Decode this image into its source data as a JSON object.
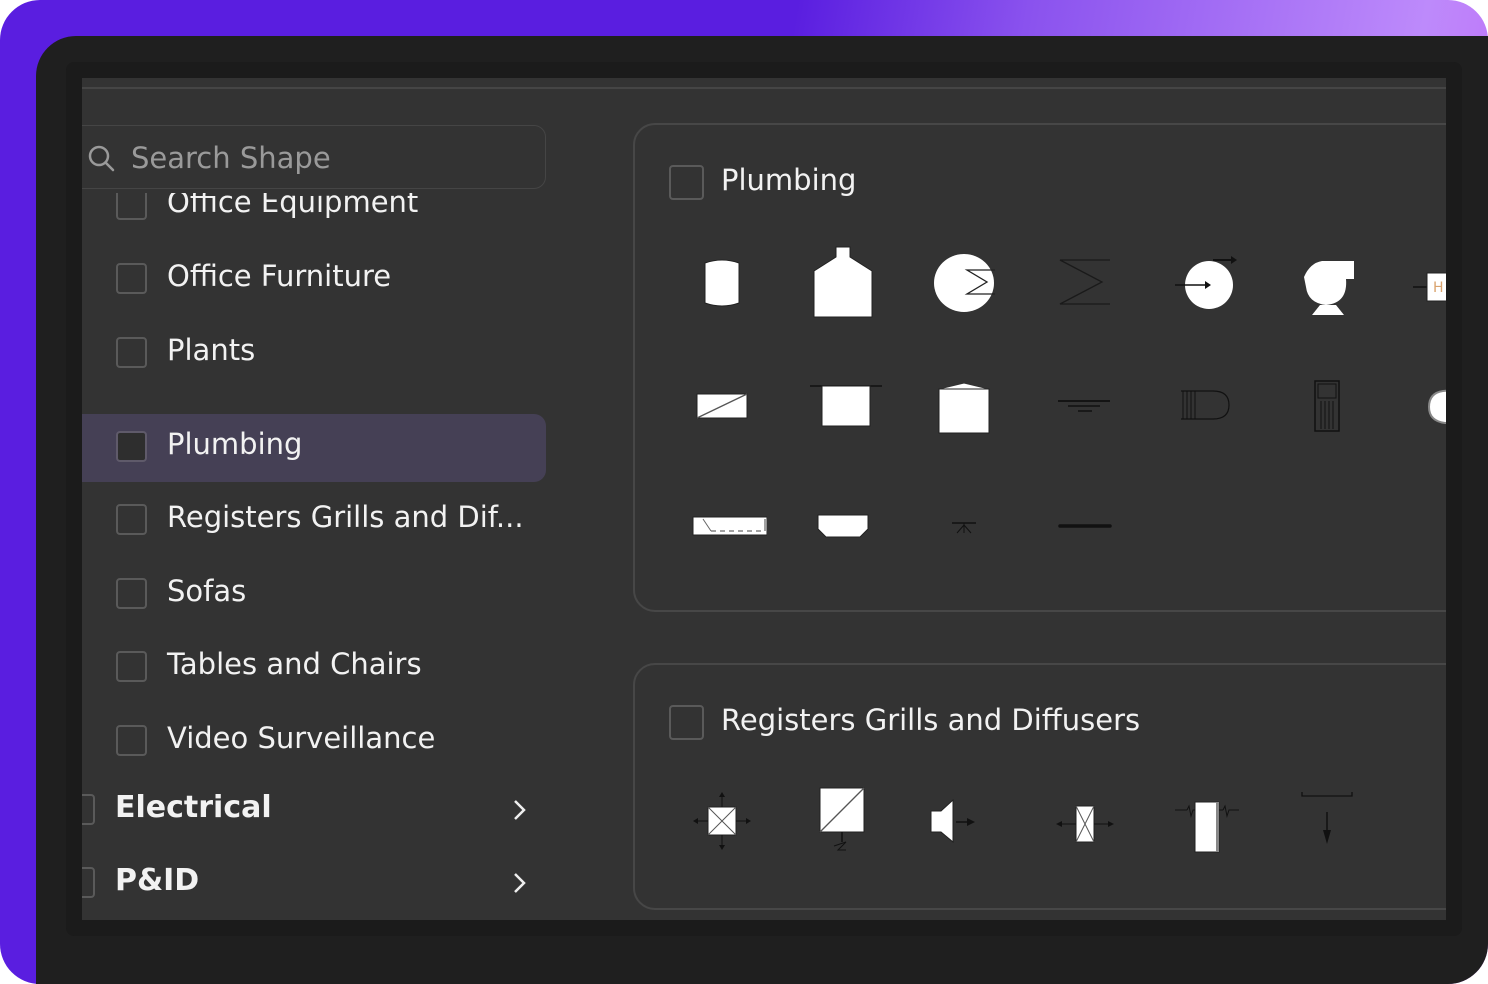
{
  "search": {
    "placeholder": "Search Shape",
    "value": ""
  },
  "sidebar": {
    "items": [
      {
        "label": "Office Equipment",
        "checked": false,
        "selected": false
      },
      {
        "label": "Office Furniture",
        "checked": false,
        "selected": false
      },
      {
        "label": "Plants",
        "checked": false,
        "selected": false
      },
      {
        "label": "Plumbing",
        "checked": false,
        "selected": true
      },
      {
        "label": "Registers Grills and Dif...",
        "checked": false,
        "selected": false
      },
      {
        "label": "Sofas",
        "checked": false,
        "selected": false
      },
      {
        "label": "Tables and Chairs",
        "checked": false,
        "selected": false
      },
      {
        "label": "Video Surveillance",
        "checked": false,
        "selected": false
      }
    ],
    "groups": [
      {
        "label": "Electrical",
        "icon": "chevron-right-icon"
      },
      {
        "label": "P&ID",
        "icon": "chevron-right-icon"
      }
    ]
  },
  "panels": [
    {
      "title": "Plumbing",
      "checked": false,
      "shapes": [
        "water-tank",
        "bottle-tank",
        "heat-exchanger",
        "zigzag-coil",
        "pump-rotary",
        "blower-fan",
        "hot-water-heater",
        "diagonal-box",
        "square-tank",
        "peaked-tank",
        "floor-drain",
        "wall-hydrant",
        "cabinet-unit",
        "toilet-bowl",
        "bathtub",
        "sink-basin",
        "valve-small",
        "pipe-line"
      ]
    },
    {
      "title": "Registers Grills and Diffusers",
      "checked": false,
      "shapes": [
        "four-way-diffuser",
        "return-grille",
        "speaker-diffuser",
        "damper-box",
        "linear-slot",
        "drop-arrow"
      ]
    }
  ],
  "colors": {
    "accent_gradient_start": "#5a1ee0",
    "accent_gradient_end": "#c25af5",
    "app_background": "#333333",
    "selected_row": "#454055",
    "text": "#f2f2f2"
  }
}
